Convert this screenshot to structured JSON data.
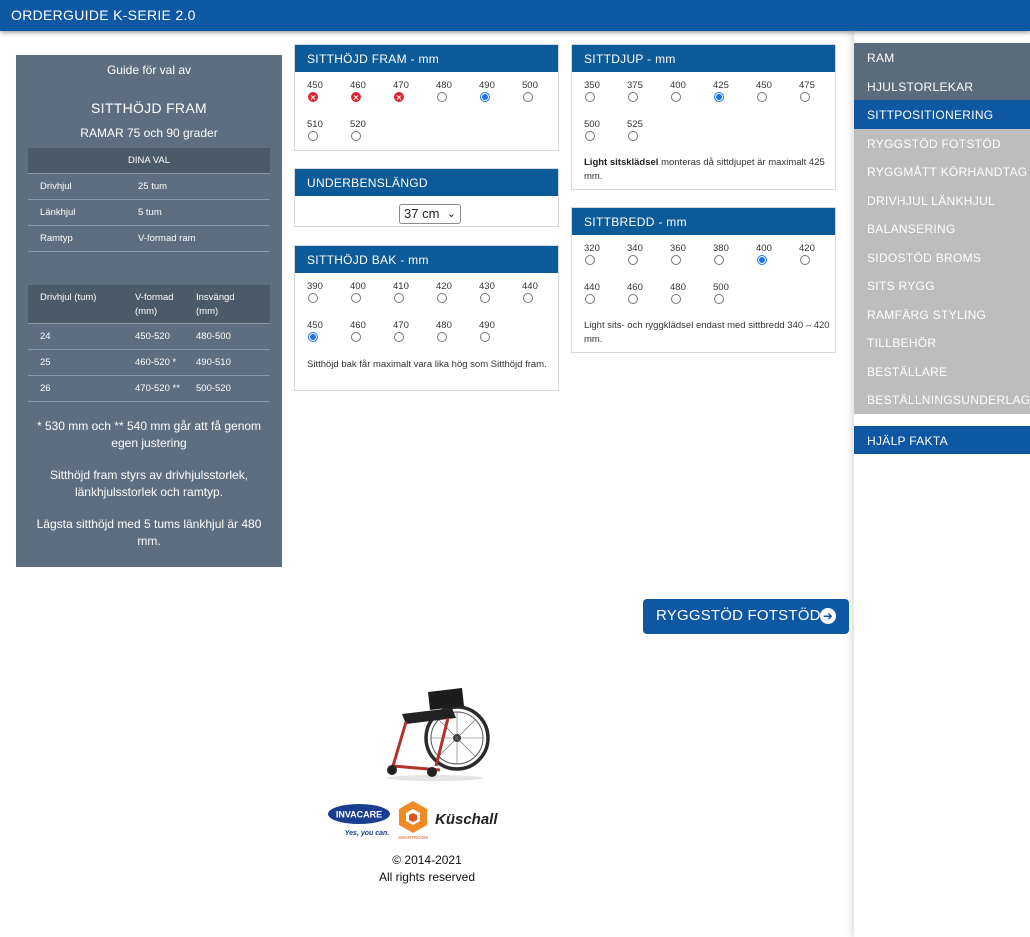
{
  "header": {
    "title": "ORDERGUIDE K-SERIE 2.0"
  },
  "guide": {
    "top": "Guide för val av",
    "heading": "SITTHÖJD FRAM",
    "subheading": "RAMAR 75 och 90 grader",
    "choices_header": "DINA VAL",
    "choices": [
      {
        "label": "Drivhjul",
        "value": "25 tum"
      },
      {
        "label": "Länkhjul",
        "value": "5 tum"
      },
      {
        "label": "Ramtyp",
        "value": "V-formad ram"
      }
    ],
    "table_headers": [
      "Drivhjul (tum)",
      "V-formad (mm)",
      "Insvängd (mm)"
    ],
    "table_rows": [
      [
        "24",
        "450-520",
        "480-500"
      ],
      [
        "25",
        "460-520 *",
        "490-510"
      ],
      [
        "26",
        "470-520 **",
        "500-520"
      ]
    ],
    "note1": "* 530 mm och ** 540 mm går att få genom egen justering",
    "note2": "Sitthöjd fram styrs av drivhjulsstorlek, länkhjulsstorlek och ramtyp.",
    "note3": "Lägsta sitthöjd med 5 tums länkhjul är 480 mm."
  },
  "sitthojd_fram": {
    "title": "SITTHÖJD FRAM - mm",
    "options": [
      {
        "label": "450",
        "state": "disabled"
      },
      {
        "label": "460",
        "state": "disabled"
      },
      {
        "label": "470",
        "state": "disabled"
      },
      {
        "label": "480",
        "state": "off"
      },
      {
        "label": "490",
        "state": "selected"
      },
      {
        "label": "500",
        "state": "off"
      },
      {
        "label": "510",
        "state": "off"
      },
      {
        "label": "520",
        "state": "off"
      }
    ]
  },
  "underbenslangd": {
    "title": "UNDERBENSLÄNGD",
    "selected": "37 cm"
  },
  "sitthojd_bak": {
    "title": "SITTHÖJD BAK - mm",
    "options": [
      {
        "label": "390",
        "state": "off"
      },
      {
        "label": "400",
        "state": "off"
      },
      {
        "label": "410",
        "state": "off"
      },
      {
        "label": "420",
        "state": "off"
      },
      {
        "label": "430",
        "state": "off"
      },
      {
        "label": "440",
        "state": "off"
      },
      {
        "label": "450",
        "state": "selected"
      },
      {
        "label": "460",
        "state": "off"
      },
      {
        "label": "470",
        "state": "off"
      },
      {
        "label": "480",
        "state": "off"
      },
      {
        "label": "490",
        "state": "off"
      }
    ],
    "note": "Sitthöjd bak får maximalt vara lika hög som Sitthöjd fram."
  },
  "sittdjup": {
    "title": "SITTDJUP - mm",
    "options": [
      {
        "label": "350",
        "state": "off"
      },
      {
        "label": "375",
        "state": "off"
      },
      {
        "label": "400",
        "state": "off"
      },
      {
        "label": "425",
        "state": "selected"
      },
      {
        "label": "450",
        "state": "off"
      },
      {
        "label": "475",
        "state": "off"
      },
      {
        "label": "500",
        "state": "off"
      },
      {
        "label": "525",
        "state": "off"
      }
    ],
    "note_bold": "Light sitsklädsel",
    "note": " monteras då sittdjupet är maximalt 425 mm."
  },
  "sittbredd": {
    "title": "SITTBREDD - mm",
    "options": [
      {
        "label": "320",
        "state": "off"
      },
      {
        "label": "340",
        "state": "off"
      },
      {
        "label": "360",
        "state": "off"
      },
      {
        "label": "380",
        "state": "off"
      },
      {
        "label": "400",
        "state": "selected"
      },
      {
        "label": "420",
        "state": "off"
      },
      {
        "label": "440",
        "state": "off"
      },
      {
        "label": "460",
        "state": "off"
      },
      {
        "label": "480",
        "state": "off"
      },
      {
        "label": "500",
        "state": "off"
      }
    ],
    "note": "Light sits- och ryggklädsel endast med sittbredd 340 – 420 mm."
  },
  "nav": {
    "items": [
      {
        "label": "RAM",
        "style": "dark"
      },
      {
        "label": "HJULSTORLEKAR",
        "style": "dark"
      },
      {
        "label": "SITTPOSITIONERING",
        "style": "active"
      },
      {
        "label": "RYGGSTÖD FOTSTÖD",
        "style": "light"
      },
      {
        "label": "RYGGMÅTT KÖRHANDTAG",
        "style": "light"
      },
      {
        "label": "DRIVHJUL LÄNKHJUL",
        "style": "light"
      },
      {
        "label": "BALANSERING",
        "style": "light"
      },
      {
        "label": "SIDOSTÖD BROMS",
        "style": "light"
      },
      {
        "label": "SITS RYGG",
        "style": "light"
      },
      {
        "label": "RAMFÄRG STYLING",
        "style": "light"
      },
      {
        "label": "TILLBEHÖR",
        "style": "light"
      },
      {
        "label": "BESTÄLLARE",
        "style": "light"
      },
      {
        "label": "BESTÄLLNINGSUNDERLAG",
        "style": "light"
      }
    ],
    "help": "HJÄLP FAKTA"
  },
  "next_button": {
    "label": "RYGGSTÖD FOTSTÖD"
  },
  "footer": {
    "invacare": "INVACARE",
    "tagline": "Yes, you can.",
    "smartroom": "SMARTROOM",
    "kuschall": "Küschall",
    "copyright": "© 2014-2021",
    "rights": "All rights reserved"
  },
  "colors": {
    "brand_blue": "#0d57a3",
    "box_header": "#0d5a98",
    "guide_panel": "#5c6e7f",
    "nav_inactive": "#bdbdbd",
    "disabled_red": "#e0242f"
  }
}
